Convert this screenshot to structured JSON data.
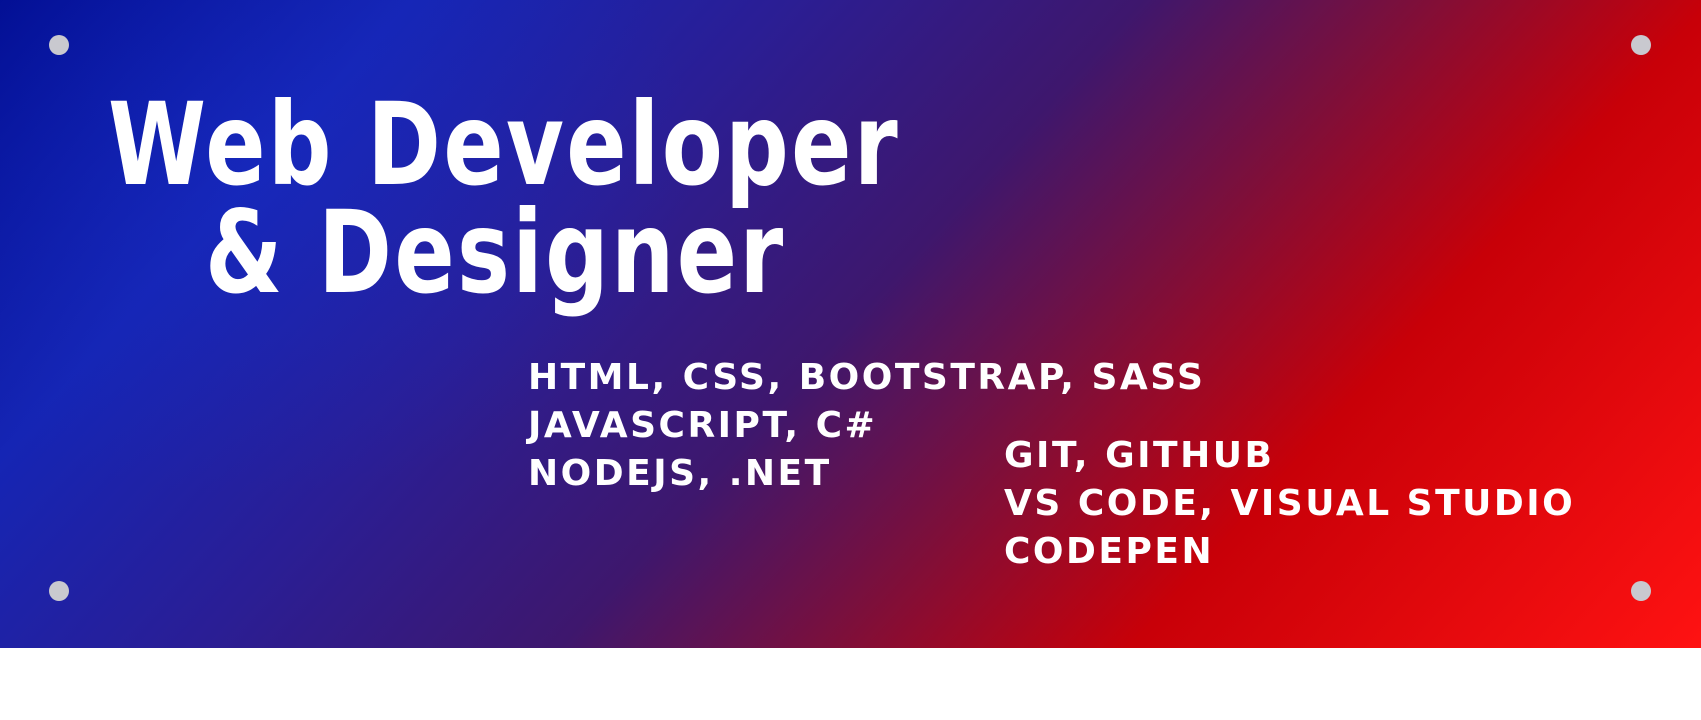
{
  "banner": {
    "headline": {
      "line1": "Web Developer",
      "line2": "& Designer"
    },
    "skills_left": [
      "HTML, CSS, BOOTSTRAP, SASS",
      "JAVASCRIPT, C#",
      "NODEJS, .NET"
    ],
    "skills_right": [
      "GIT, GITHUB",
      "VS CODE, VISUAL STUDIO",
      "CODEPEN"
    ],
    "colors": {
      "gradient_start": "#000c8f",
      "gradient_mid_blue": "#1525b4",
      "gradient_mid_purple": "#3e176d",
      "gradient_end": "#ff1212",
      "text": "#ffffff",
      "rivet": "#c9c9cf",
      "background": "#ffffff"
    },
    "rivet_icons": [
      "rivet-dot-icon",
      "rivet-dot-icon",
      "rivet-dot-icon",
      "rivet-dot-icon"
    ]
  }
}
